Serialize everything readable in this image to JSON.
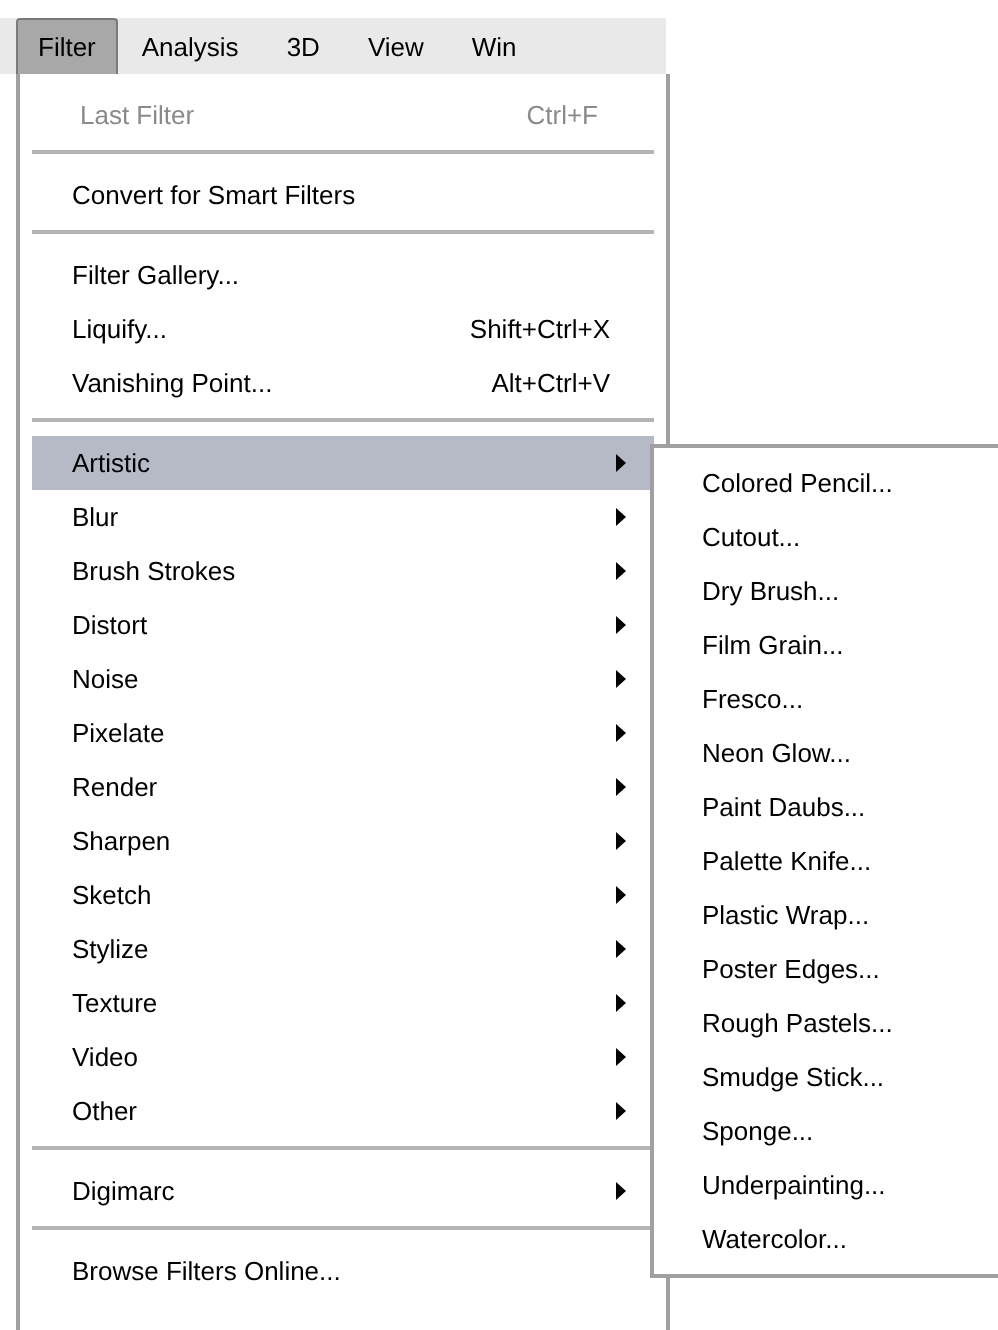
{
  "menu_bar": [
    {
      "label": "Filter",
      "selected": true
    },
    {
      "label": "Analysis",
      "selected": false
    },
    {
      "label": "3D",
      "selected": false
    },
    {
      "label": "View",
      "selected": false
    },
    {
      "label": "Win",
      "selected": false
    }
  ],
  "menu": {
    "groups": [
      [
        {
          "label": "Last Filter",
          "shortcut": "Ctrl+F",
          "disabled": true,
          "submenu": false,
          "selected": false
        }
      ],
      [
        {
          "label": "Convert for Smart Filters",
          "disabled": false,
          "submenu": false,
          "selected": false
        }
      ],
      [
        {
          "label": "Filter Gallery...",
          "disabled": false,
          "submenu": false,
          "selected": false
        },
        {
          "label": "Liquify...",
          "shortcut": "Shift+Ctrl+X",
          "disabled": false,
          "submenu": false,
          "selected": false
        },
        {
          "label": "Vanishing Point...",
          "shortcut": "Alt+Ctrl+V",
          "disabled": false,
          "submenu": false,
          "selected": false
        }
      ],
      [
        {
          "label": "Artistic",
          "disabled": false,
          "submenu": true,
          "selected": true
        },
        {
          "label": "Blur",
          "disabled": false,
          "submenu": true,
          "selected": false
        },
        {
          "label": "Brush Strokes",
          "disabled": false,
          "submenu": true,
          "selected": false
        },
        {
          "label": "Distort",
          "disabled": false,
          "submenu": true,
          "selected": false
        },
        {
          "label": "Noise",
          "disabled": false,
          "submenu": true,
          "selected": false
        },
        {
          "label": "Pixelate",
          "disabled": false,
          "submenu": true,
          "selected": false
        },
        {
          "label": "Render",
          "disabled": false,
          "submenu": true,
          "selected": false
        },
        {
          "label": "Sharpen",
          "disabled": false,
          "submenu": true,
          "selected": false
        },
        {
          "label": "Sketch",
          "disabled": false,
          "submenu": true,
          "selected": false
        },
        {
          "label": "Stylize",
          "disabled": false,
          "submenu": true,
          "selected": false
        },
        {
          "label": "Texture",
          "disabled": false,
          "submenu": true,
          "selected": false
        },
        {
          "label": "Video",
          "disabled": false,
          "submenu": true,
          "selected": false
        },
        {
          "label": "Other",
          "disabled": false,
          "submenu": true,
          "selected": false
        }
      ],
      [
        {
          "label": "Digimarc",
          "disabled": false,
          "submenu": true,
          "selected": false
        }
      ],
      [
        {
          "label": "Browse Filters Online...",
          "disabled": false,
          "submenu": false,
          "selected": false
        }
      ]
    ]
  },
  "submenu": {
    "items": [
      "Colored Pencil...",
      "Cutout...",
      "Dry Brush...",
      "Film Grain...",
      "Fresco...",
      "Neon Glow...",
      "Paint Daubs...",
      "Palette Knife...",
      "Plastic Wrap...",
      "Poster Edges...",
      "Rough Pastels...",
      "Smudge Stick...",
      "Sponge...",
      "Underpainting...",
      "Watercolor..."
    ]
  }
}
